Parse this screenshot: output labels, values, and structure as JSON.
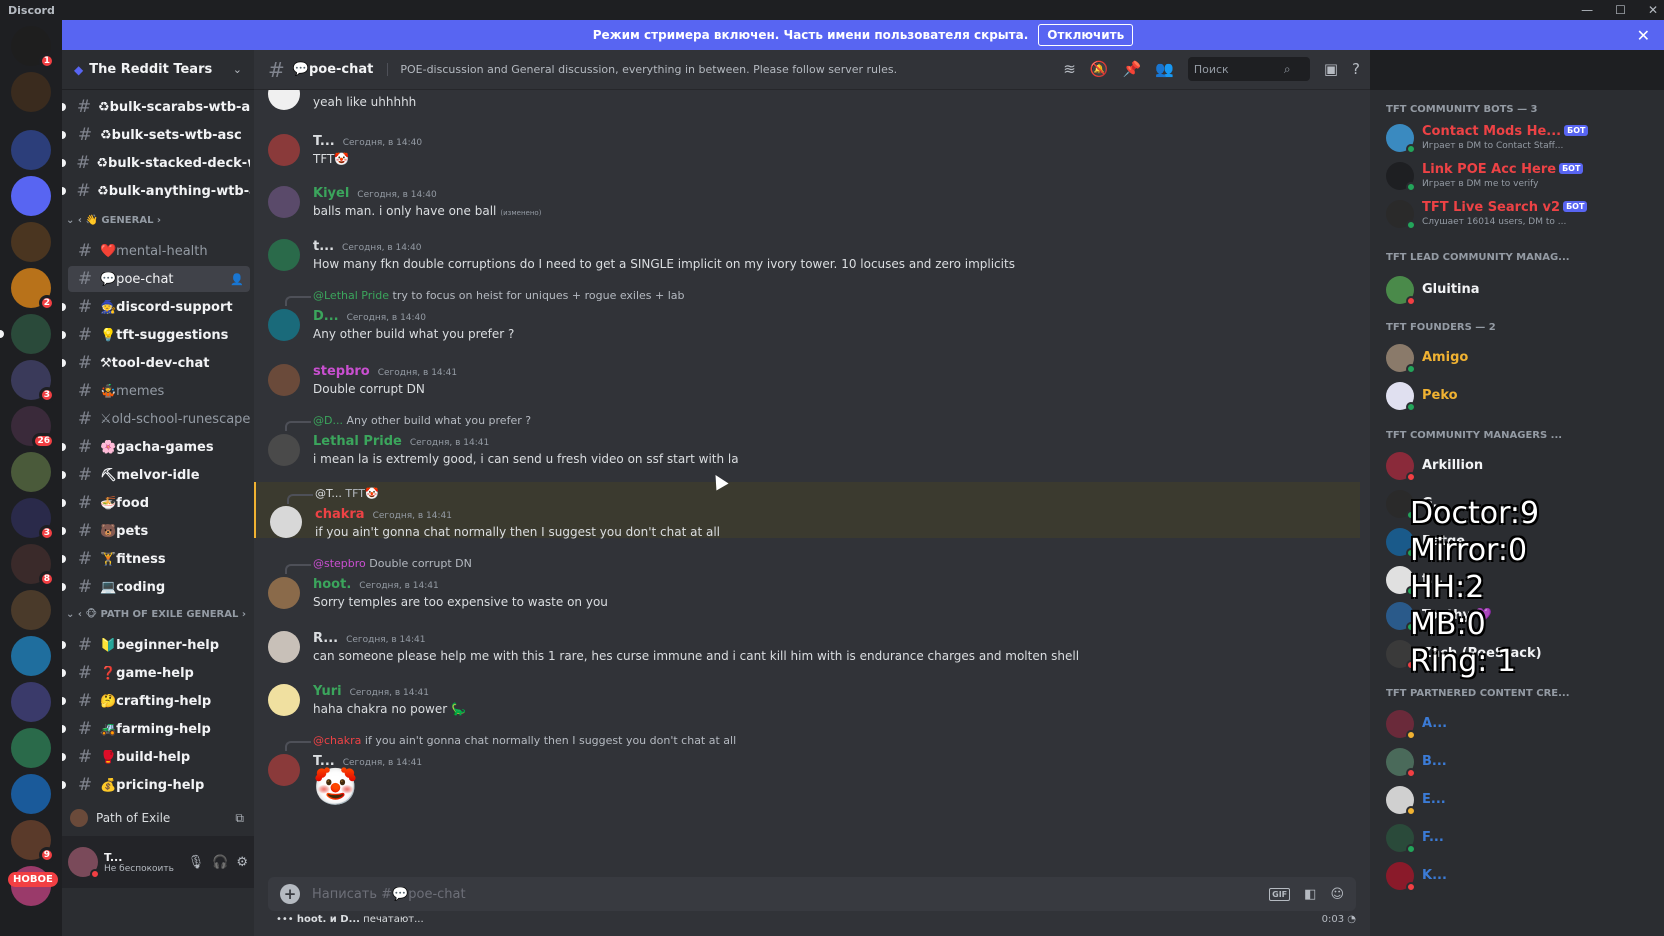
{
  "window": {
    "app_name": "Discord"
  },
  "banner": {
    "text": "Режим стримера включен. Часть имени пользователя скрыта.",
    "button_label": "Отключить"
  },
  "rail": {
    "badges": [
      "1",
      "2",
      "3",
      "26",
      "3",
      "8",
      "9"
    ],
    "new_label": "НОВОЕ",
    "colors": [
      "#1e1e1e",
      "#3a2b1e",
      "#2c3e7a",
      "#5865f2",
      "#4a3520",
      "#b8721a",
      "#2a4a3a",
      "#3a3a5a",
      "#3a2a3a",
      "#4a5a3a",
      "#2a2a4a",
      "#3a2a2a",
      "#4a3a2a",
      "#1f6e9e",
      "#3a3a6a",
      "#2a6a4a",
      "#1a5a9a",
      "#5a3a2a",
      "#9a3a6a",
      "#3a2a2a"
    ]
  },
  "server": {
    "name": "The Reddit Tears"
  },
  "channels": [
    {
      "label": "♻bulk-scarabs-wtb-asc",
      "unread": true
    },
    {
      "label": "♻bulk-sets-wtb-asc",
      "unread": true
    },
    {
      "label": "♻bulk-stacked-deck-wt...",
      "unread": true
    },
    {
      "label": "♻bulk-anything-wtb-asc",
      "unread": true
    },
    {
      "label": "❤️mental-health",
      "unread": false
    },
    {
      "label": "💬poe-chat",
      "unread": false
    },
    {
      "label": "🧙discord-support",
      "unread": true
    },
    {
      "label": "💡tft-suggestions",
      "unread": true
    },
    {
      "label": "⚒tool-dev-chat",
      "unread": true
    },
    {
      "label": "🤹memes",
      "unread": false
    },
    {
      "label": "⚔old-school-runescape",
      "unread": false
    },
    {
      "label": "🌸gacha-games",
      "unread": true
    },
    {
      "label": "⛏melvor-idle",
      "unread": true
    },
    {
      "label": "🍜food",
      "unread": true
    },
    {
      "label": "🐻pets",
      "unread": true
    },
    {
      "label": "🏋fitness",
      "unread": true
    },
    {
      "label": "💻coding",
      "unread": true
    },
    {
      "label": "🔰beginner-help",
      "unread": true
    },
    {
      "label": "❓game-help",
      "unread": true
    },
    {
      "label": "🤔crafting-help",
      "unread": true
    },
    {
      "label": "🚜farming-help",
      "unread": true
    },
    {
      "label": "🥊build-help",
      "unread": true
    },
    {
      "label": "💰pricing-help",
      "unread": true
    }
  ],
  "categories": [
    "👋 GENERAL",
    "🐵 PATH OF EXILE GENERAL"
  ],
  "voice": {
    "channel": "Path of Exile"
  },
  "user": {
    "name": "T...",
    "status": "Не беспокоить"
  },
  "chat": {
    "channel_name": "poe-chat",
    "topic": "POE-discussion and General discussion, everything in between. Please follow server rules.",
    "search_placeholder": "Поиск",
    "composer_placeholder": "Написать #💬poe-chat",
    "typing_names": "hoot. и D...",
    "typing_suffix": " печатают...",
    "timer": "0:03"
  },
  "messages": [
    {
      "text": "yeah like uhhhhh"
    },
    {
      "user": "T...",
      "color": "#dbdee1",
      "ts": "Сегодня, в 14:40",
      "text": "TFT🤡",
      "av": "#8a3a3a"
    },
    {
      "user": "Kiyel",
      "color": "#3ba55c",
      "ts": "Сегодня, в 14:40",
      "text": "balls man. i only have one ball",
      "edited": "(изменено)",
      "av": "#5a4a6a"
    },
    {
      "user": "t...",
      "color": "#dbdee1",
      "ts": "Сегодня, в 14:40",
      "text": "How many fkn double corruptions do I need to get a SINGLE implicit on my ivory tower. 10 locuses and zero implicits",
      "av": "#2a6a4a"
    },
    {
      "reply_user": "@Lethal Pride",
      "reply_color": "#3ba55c",
      "reply_text": " try to focus on heist for uniques + rogue exiles + lab",
      "user": "D...",
      "color": "#3ba55c",
      "ts": "Сегодня, в 14:40",
      "text": "Any other build what you prefer ?",
      "av": "#1a6a7a"
    },
    {
      "user": "stepbro",
      "color": "#c94fd0",
      "ts": "Сегодня, в 14:41",
      "text": "Double corrupt DN",
      "av": "#6a4a3a"
    },
    {
      "reply_user": "@D...",
      "reply_color": "#3ba55c",
      "reply_text": " Any other build what you prefer ?",
      "user": "Lethal Pride",
      "color": "#3ba55c",
      "ts": "Сегодня, в 14:41",
      "text": "i mean la is extremly good, i can send u fresh video on ssf start with la",
      "av": "#4a4a4a"
    },
    {
      "reply_user": "@T...",
      "reply_color": "#dbdee1",
      "reply_text": " TFT🤡",
      "user": "chakra",
      "color": "#ed4245",
      "ts": "Сегодня, в 14:41",
      "text": "if you ain't gonna chat normally then I suggest you don't chat at all",
      "av": "#d8d8d8"
    },
    {
      "reply_user": "@stepbro",
      "reply_color": "#c94fd0",
      "reply_text": " Double corrupt DN",
      "user": "hoot.",
      "color": "#3ba55c",
      "ts": "Сегодня, в 14:41",
      "text": "Sorry temples are too expensive to waste on you",
      "av": "#8a6a4a"
    },
    {
      "user": "R...",
      "color": "#dbdee1",
      "ts": "Сегодня, в 14:41",
      "text": "can someone please help me with this 1 rare, hes curse immune and i cant kill him with is endurance charges and molten shell",
      "av": "#c8c0b8"
    },
    {
      "user": "Yuri",
      "color": "#3ba55c",
      "ts": "Сегодня, в 14:41",
      "text": "haha chakra no power 🦕",
      "av": "#f0e0a0"
    },
    {
      "reply_user": "@chakra",
      "reply_color": "#ed4245",
      "reply_text": " if you ain't gonna chat normally then I suggest you don't chat at all",
      "user": "T...",
      "color": "#dbdee1",
      "ts": "Сегодня, в 14:41",
      "text": "🤡",
      "av": "#8a3a3a"
    }
  ],
  "members": {
    "cat_bots": "TFT COMMUNITY BOTS — 3",
    "cat_lead": "TFT LEAD COMMUNITY MANAG...",
    "cat_founders": "TFT FOUNDERS — 2",
    "cat_managers": "TFT COMMUNITY MANAGERS ...",
    "cat_partnered": "TFT PARTNERED CONTENT CRE...",
    "bot_tag": "БОТ",
    "list": [
      {
        "name": "Contact Mods He...",
        "act": "Играет в DM to Contact Staff...",
        "color": "#ed4245",
        "bot": true,
        "av": "#3a8ac0",
        "st": "#23a55a"
      },
      {
        "name": "Link POE Acc Here",
        "act": "Играет в DM me to verify",
        "color": "#ed4245",
        "bot": true,
        "av": "#1e1f22",
        "st": "#23a55a"
      },
      {
        "name": "TFT Live Search v2",
        "act": "Слушает 16014 users, DM to ...",
        "color": "#ed4245",
        "bot": true,
        "av": "#2a2a2a",
        "st": "#23a55a"
      },
      {
        "name": "Gluitina",
        "act": "",
        "color": "#f2f3f5",
        "bot": false,
        "av": "#4a8a4a",
        "st": "#f23f43"
      },
      {
        "name": "Amigo",
        "act": "",
        "color": "#f0b232",
        "bot": false,
        "av": "#8a7a6a",
        "st": "#23a55a"
      },
      {
        "name": "Peko",
        "act": "",
        "color": "#f0b232",
        "bot": false,
        "av": "#e0e0f0",
        "st": "#23a55a"
      },
      {
        "name": "Arkillion",
        "act": "",
        "color": "#f2f3f5",
        "bot": false,
        "av": "#8a2a3a",
        "st": "#f23f43"
      },
      {
        "name": "G...",
        "act": "",
        "color": "#f2f3f5",
        "bot": false,
        "av": "#2a2a2a",
        "st": "#23a55a"
      },
      {
        "name": "Ratge",
        "act": "",
        "color": "#f2f3f5",
        "bot": false,
        "av": "#1a5a8a",
        "st": "#23a55a"
      },
      {
        "name": "t...",
        "act": "",
        "color": "#f2f3f5",
        "bot": false,
        "av": "#e0e0e0",
        "st": "#23a55a"
      },
      {
        "name": "Toothy 💜",
        "act": "",
        "color": "#f2f3f5",
        "bot": false,
        "av": "#2a5a8a",
        "st": "#23a55a"
      },
      {
        "name": "Zach (PoeStack)",
        "act": "",
        "color": "#f2f3f5",
        "bot": false,
        "av": "#3a3a3a",
        "st": "#f23f43"
      },
      {
        "name": "A...",
        "act": "",
        "color": "#3b7bd6",
        "bot": false,
        "av": "#6a2a3a",
        "st": "#f0b232"
      },
      {
        "name": "B...",
        "act": "",
        "color": "#3b7bd6",
        "bot": false,
        "av": "#4a6a5a",
        "st": "#f23f43"
      },
      {
        "name": "E...",
        "act": "",
        "color": "#3b7bd6",
        "bot": false,
        "av": "#d0d0d0",
        "st": "#f0b232"
      },
      {
        "name": "F...",
        "act": "",
        "color": "#3b7bd6",
        "bot": false,
        "av": "#2a4a3a",
        "st": "#23a55a"
      },
      {
        "name": "K...",
        "act": "",
        "color": "#3b7bd6",
        "bot": false,
        "av": "#8a1a2a",
        "st": "#f23f43"
      }
    ]
  },
  "overlay": [
    "Doctor:9",
    "Mirror:0",
    "HH:2",
    "MB:0",
    "Ring: 1"
  ]
}
